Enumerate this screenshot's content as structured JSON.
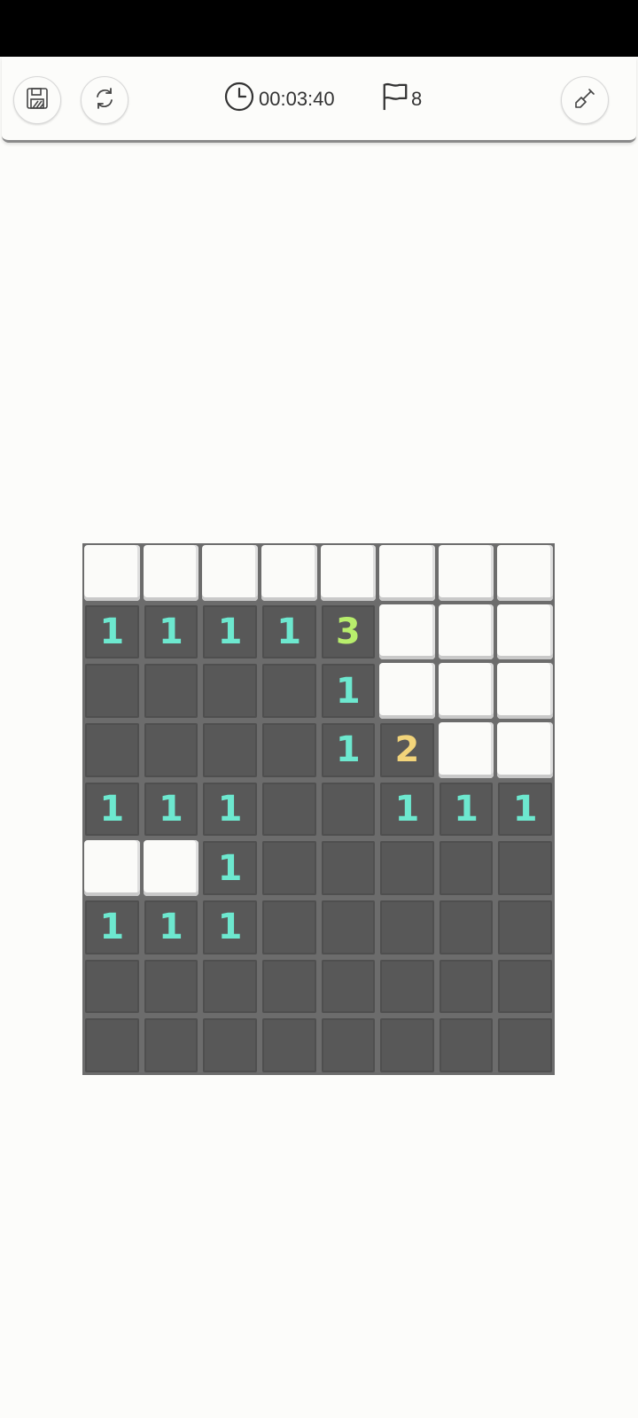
{
  "toolbar": {
    "save_icon": "save-icon",
    "restart_icon": "restart-icon",
    "timer_icon": "clock-icon",
    "timer": "00:03:40",
    "flag_icon": "flag-icon",
    "flags": "8",
    "tool_icon": "shovel-icon"
  },
  "colors": {
    "one": "#6de8cf",
    "two": "#f2d47a",
    "three": "#b8ee6c",
    "covered": "#fbfbf9",
    "open": "#585858",
    "grid": "#6c6c6c"
  },
  "board": {
    "cols": 8,
    "rows": [
      [
        "#",
        "#",
        "#",
        "#",
        "#",
        "#",
        "#",
        "#"
      ],
      [
        "1",
        "1",
        "1",
        "1",
        "3",
        "#",
        "#",
        "#"
      ],
      [
        "",
        "",
        "",
        "",
        "1",
        "#",
        "#",
        "#"
      ],
      [
        "",
        "",
        "",
        "",
        "1",
        "2",
        "#",
        "#"
      ],
      [
        "1",
        "1",
        "1",
        "",
        "",
        "1",
        "1",
        "1"
      ],
      [
        "#",
        "#",
        "1",
        "",
        "",
        "",
        "",
        ""
      ],
      [
        "1",
        "1",
        "1",
        "",
        "",
        "",
        "",
        ""
      ],
      [
        "",
        "",
        "",
        "",
        "",
        "",
        "",
        ""
      ],
      [
        "",
        "",
        "",
        "",
        "",
        "",
        "",
        ""
      ]
    ]
  }
}
